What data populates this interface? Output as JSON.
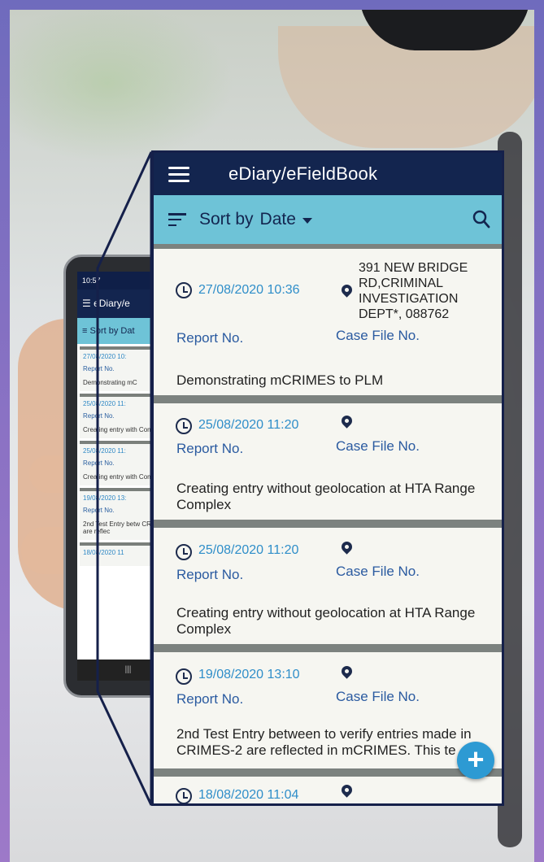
{
  "app": {
    "title": "eDiary/eFieldBook",
    "phone_title_short": "eDiary/e"
  },
  "sort": {
    "label": "Sort by",
    "value": "Date",
    "short": "Sort by Dat"
  },
  "phone": {
    "status_time": "10:57",
    "cards": [
      {
        "date": "27/08/2020 10:",
        "report": "Report No.",
        "desc": "Demonstrating mC"
      },
      {
        "date": "25/08/2020 11:",
        "report": "Report No.",
        "desc": "Creating entry with Complex"
      },
      {
        "date": "25/08/2020 11:",
        "report": "Report No.",
        "desc": "Creating entry with Complex"
      },
      {
        "date": "19/08/2020 13:",
        "report": "Report No.",
        "desc": "2nd Test Entry betw CRIMES-2 are reflec"
      },
      {
        "date": "18/08/2020 11",
        "report": "",
        "desc": ""
      }
    ]
  },
  "entries": [
    {
      "date": "27/08/2020 10:36",
      "address": [
        "391 NEW BRIDGE",
        "RD,CRIMINAL",
        "INVESTIGATION",
        "DEPT*, 088762"
      ],
      "report_label": "Report No.",
      "case_label": "Case File No.",
      "description": "Demonstrating mCRIMES to PLM"
    },
    {
      "date": "25/08/2020 11:20",
      "report_label": "Report No.",
      "case_label": "Case File No.",
      "description": "Creating entry without geolocation at HTA Range Complex"
    },
    {
      "date": "25/08/2020 11:20",
      "report_label": "Report No.",
      "case_label": "Case File No.",
      "description": "Creating entry without geolocation at HTA Range Complex"
    },
    {
      "date": "19/08/2020 13:10",
      "report_label": "Report No.",
      "case_label": "Case File No.",
      "description": "2nd Test Entry between to verify entries made in CRIMES-2 are reflected in mCRIMES. This te"
    },
    {
      "date": "18/08/2020 11:04"
    }
  ],
  "fab": {
    "symbol": "+"
  },
  "icons": [
    "menu-icon",
    "sort-icon",
    "caret-down-icon",
    "search-icon",
    "clock-icon",
    "location-pin-icon",
    "add-icon"
  ],
  "colors": {
    "appbar": "#13254f",
    "sortbar": "#6ec3d7",
    "date": "#2f8ec9",
    "labels": "#2a5aa0",
    "fab": "#2d9ad3"
  }
}
